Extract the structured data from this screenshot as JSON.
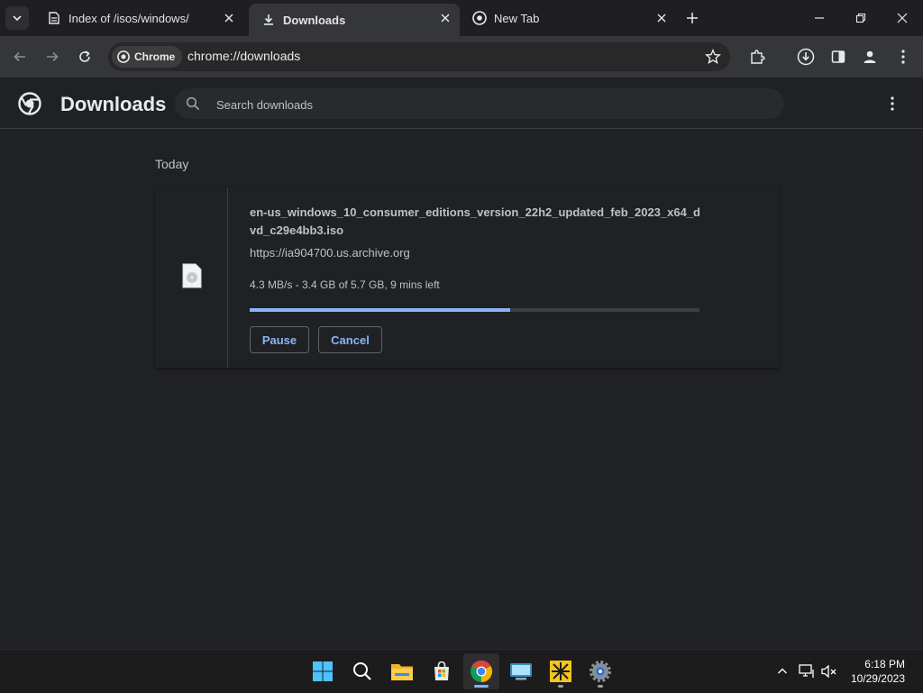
{
  "tabs": [
    {
      "title": "Index of /isos/windows/",
      "icon": "archive-icon"
    },
    {
      "title": "Downloads",
      "icon": "download-icon"
    },
    {
      "title": "New Tab",
      "icon": "chrome-icon"
    }
  ],
  "toolbar": {
    "chip_label": "Chrome",
    "url": "chrome://downloads"
  },
  "downloads": {
    "title": "Downloads",
    "search_placeholder": "Search downloads",
    "group_label": "Today",
    "item": {
      "file_name": "en-us_windows_10_consumer_editions_version_22h2_updated_feb_2023_x64_dvd_c29e4bb3.iso",
      "source_url": "https://ia904700.us.archive.org",
      "status": "4.3 MB/s - 3.4 GB of 5.7 GB, 9 mins left",
      "progress": 0.58,
      "pause_label": "Pause",
      "cancel_label": "Cancel"
    }
  },
  "taskbar": {
    "time": "6:18 PM",
    "date": "10/29/2023"
  },
  "colors": {
    "accent": "#8ab4f8",
    "background": "#202124",
    "toolbar": "#35363a"
  }
}
